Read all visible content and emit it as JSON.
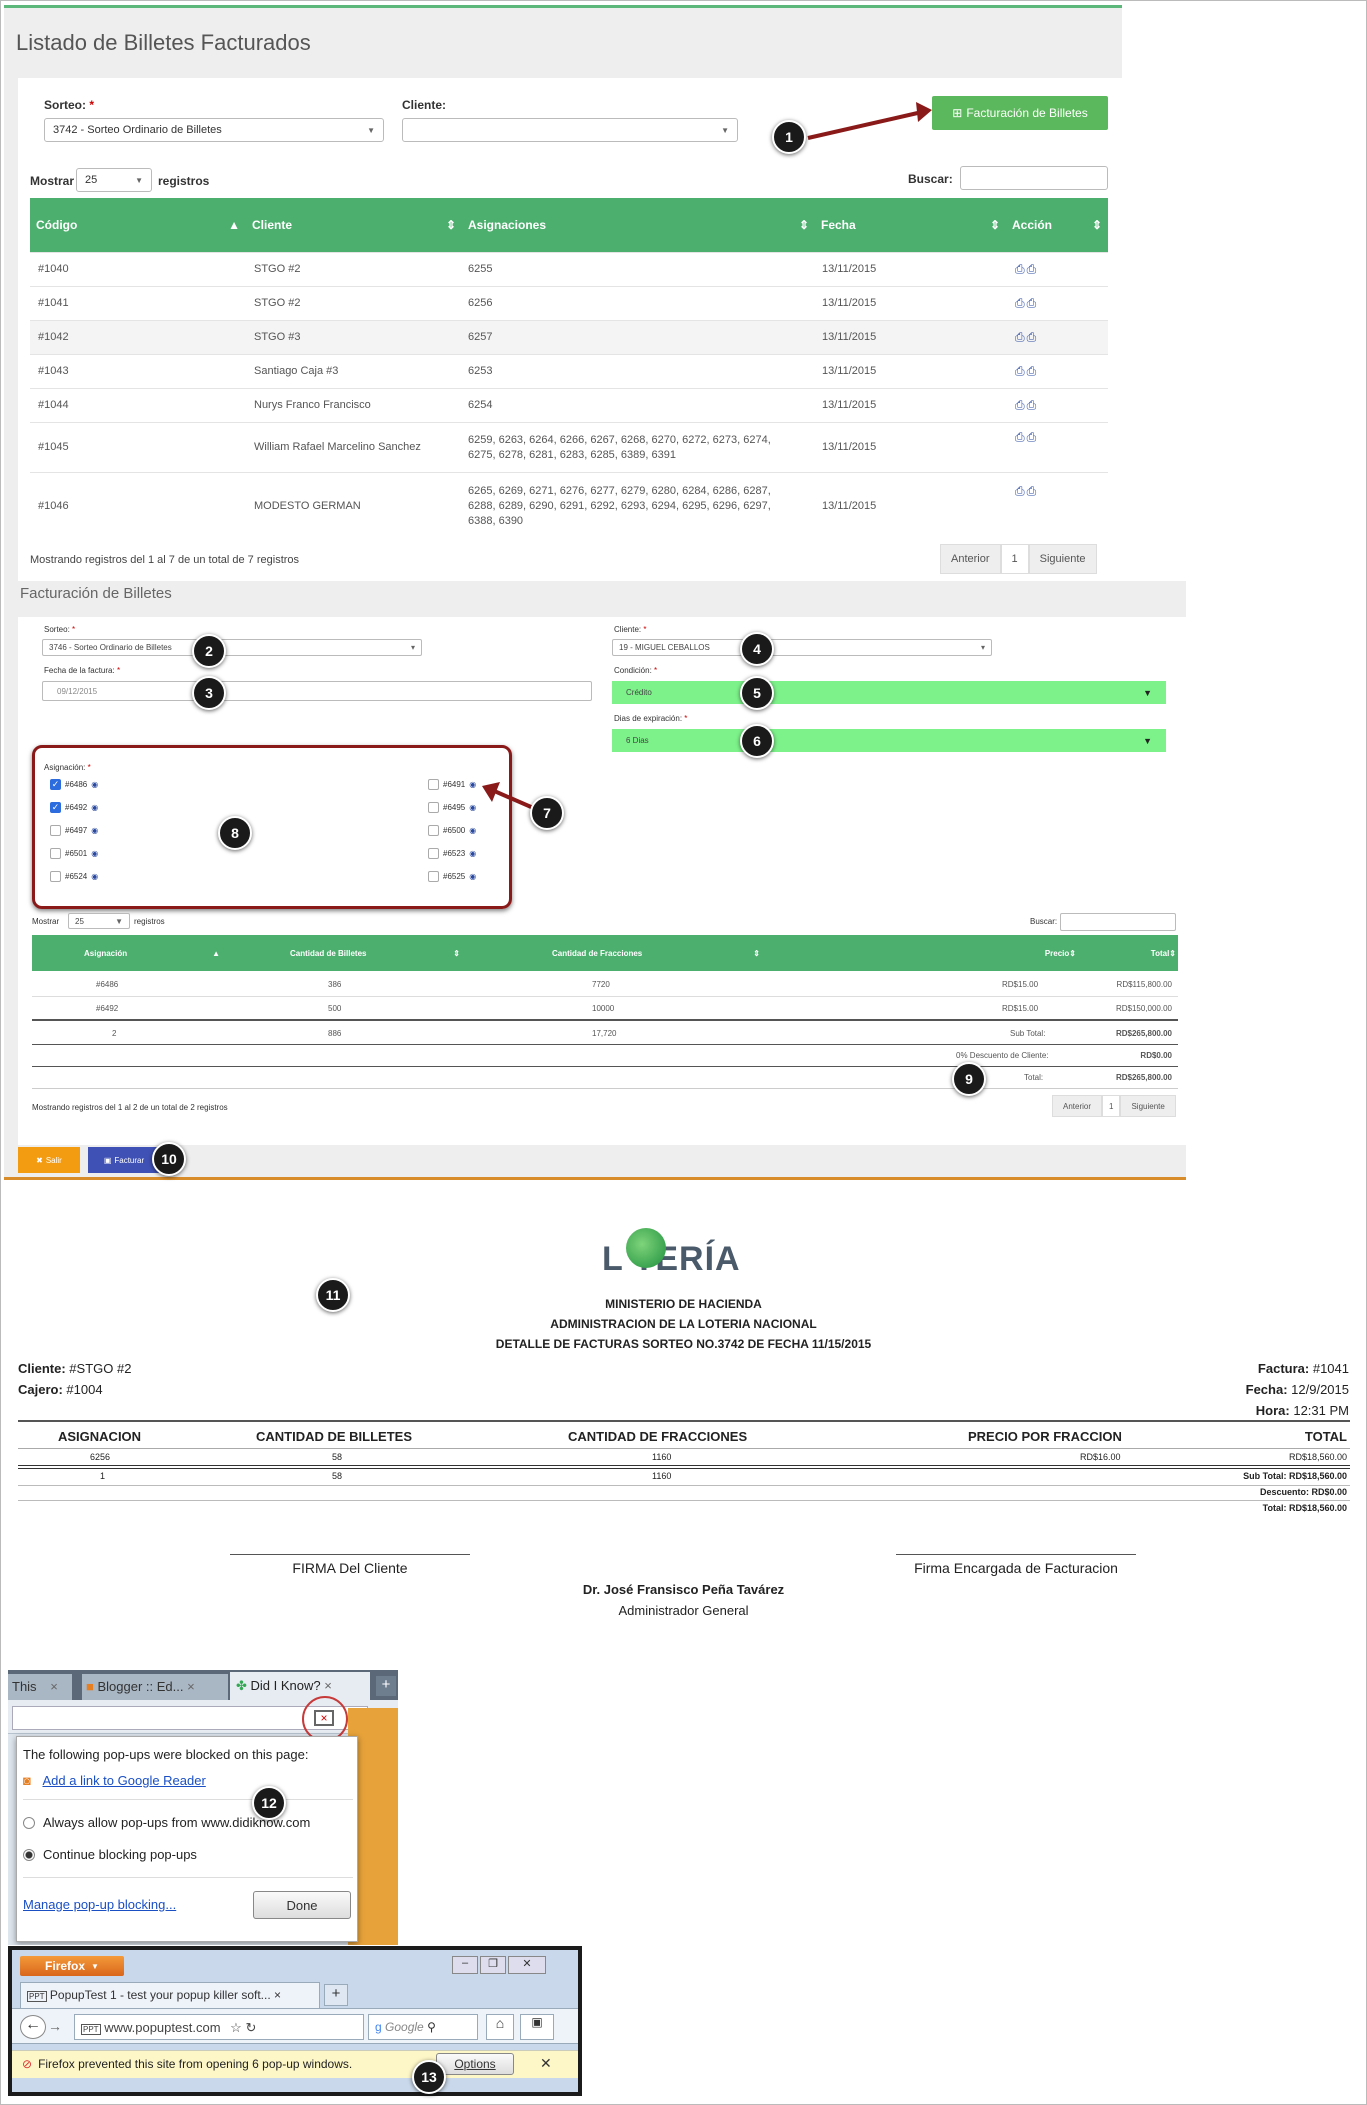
{
  "panel1": {
    "title": "Listado de Billetes Facturados",
    "sorteo_label": "Sorteo:",
    "sorteo_value": "3742 - Sorteo Ordinario de Billetes",
    "cliente_label": "Cliente:",
    "cliente_value": "",
    "add_button": "Facturación de Billetes",
    "show_label": "Mostrar",
    "show_value": "25",
    "records_label": "registros",
    "search_label": "Buscar:",
    "columns": [
      "Código",
      "Cliente",
      "Asignaciones",
      "Fecha",
      "Acción"
    ],
    "rows": [
      {
        "code": "#1040",
        "client": "STGO #2",
        "asig": "6255",
        "date": "13/11/2015"
      },
      {
        "code": "#1041",
        "client": "STGO #2",
        "asig": "6256",
        "date": "13/11/2015"
      },
      {
        "code": "#1042",
        "client": "STGO #3",
        "asig": "6257",
        "date": "13/11/2015"
      },
      {
        "code": "#1043",
        "client": "Santiago Caja #3",
        "asig": "6253",
        "date": "13/11/2015"
      },
      {
        "code": "#1044",
        "client": "Nurys Franco Francisco",
        "asig": "6254",
        "date": "13/11/2015"
      },
      {
        "code": "#1045",
        "client": "William Rafael Marcelino Sanchez",
        "asig": "6259, 6263, 6264, 6266, 6267, 6268, 6270, 6272, 6273, 6274, 6275, 6278, 6281, 6283, 6285, 6389, 6391",
        "date": "13/11/2015"
      },
      {
        "code": "#1046",
        "client": "MODESTO GERMAN",
        "asig": "6265, 6269, 6271, 6276, 6277, 6279, 6280, 6284, 6286, 6287, 6288, 6289, 6290, 6291, 6292, 6293, 6294, 6295, 6296, 6297, 6388, 6390",
        "date": "13/11/2015"
      }
    ],
    "footer_text": "Mostrando registros del 1 al 7 de un total de 7 registros",
    "prev": "Anterior",
    "page": "1",
    "next": "Siguiente"
  },
  "panel2": {
    "title": "Facturación de Billetes",
    "sorteo_label": "Sorteo:",
    "sorteo_value": "3746 - Sorteo Ordinario de Billetes",
    "fecha_label": "Fecha de la factura:",
    "fecha_value": "09/12/2015",
    "cliente_label": "Cliente:",
    "cliente_value": "19 - MIGUEL CEBALLOS",
    "condicion_label": "Condición:",
    "condicion_value": "Crédito",
    "dias_label": "Dias de expiración:",
    "dias_value": "6 Dias",
    "asig_label": "Asignación:",
    "left_items": [
      {
        "label": "#6486",
        "checked": true
      },
      {
        "label": "#6492",
        "checked": true
      },
      {
        "label": "#6497",
        "checked": false
      },
      {
        "label": "#6501",
        "checked": false
      },
      {
        "label": "#6524",
        "checked": false
      }
    ],
    "right_items": [
      {
        "label": "#6491",
        "checked": false
      },
      {
        "label": "#6495",
        "checked": false
      },
      {
        "label": "#6500",
        "checked": false
      },
      {
        "label": "#6523",
        "checked": false
      },
      {
        "label": "#6525",
        "checked": false
      }
    ],
    "show_label": "Mostrar",
    "show_value": "25",
    "records_label": "registros",
    "search_label": "Buscar:",
    "columns": [
      "Asignación",
      "Cantidad de Billetes",
      "Cantidad de Fracciones",
      "Precio",
      "Total"
    ],
    "rows": [
      {
        "a": "#6486",
        "b": "386",
        "c": "7720",
        "p": "RD$15.00",
        "t": "RD$115,800.00"
      },
      {
        "a": "#6492",
        "b": "500",
        "c": "10000",
        "p": "RD$15.00",
        "t": "RD$150,000.00"
      }
    ],
    "sum_row": {
      "a": "2",
      "b": "886",
      "c": "17,720",
      "p": "Sub Total:",
      "t": "RD$265,800.00"
    },
    "disc_row": {
      "p": "0% Descuento de Cliente:",
      "t": "RD$0.00"
    },
    "total_row": {
      "p": "Total:",
      "t": "RD$265,800.00"
    },
    "footer_text": "Mostrando registros del 1 al 2 de un total de 2 registros",
    "prev": "Anterior",
    "page": "1",
    "next": "Siguiente",
    "exit_button": "Salir",
    "bill_button": "Facturar"
  },
  "invoice": {
    "logo_text": "L TERÍA",
    "line1": "MINISTERIO DE HACIENDA",
    "line2": "ADMINISTRACION DE LA LOTERIA NACIONAL",
    "line3": "DETALLE DE FACTURAS SORTEO NO.3742 DE FECHA 11/15/2015",
    "cliente_label": "Cliente:",
    "cliente_value": "#STGO #2",
    "cajero_label": "Cajero:",
    "cajero_value": "#1004",
    "factura_label": "Factura:",
    "factura_value": "#1041",
    "fecha_label": "Fecha:",
    "fecha_value": "12/9/2015",
    "hora_label": "Hora:",
    "hora_value": "12:31 PM",
    "columns": [
      "ASIGNACION",
      "CANTIDAD DE BILLETES",
      "CANTIDAD DE FRACCIONES",
      "PRECIO POR FRACCION",
      "TOTAL"
    ],
    "row": {
      "a": "6256",
      "b": "58",
      "c": "1160",
      "p": "RD$16.00",
      "t": "RD$18,560.00"
    },
    "sum": {
      "a": "1",
      "b": "58",
      "c": "1160"
    },
    "subtotal": "Sub Total: RD$18,560.00",
    "descuento": "Descuento: RD$0.00",
    "total": "Total: RD$18,560.00",
    "sig_left": "FIRMA Del Cliente",
    "sig_right": "Firma Encargada de Facturacion",
    "admin_name": "Dr. José Fransisco Peña Tavárez",
    "admin_title": "Administrador General"
  },
  "chrome_popup": {
    "tabs": [
      "This",
      "Blogger :: Ed...",
      "Did I Know?"
    ],
    "message": "The following pop-ups were blocked on this page:",
    "link": "Add a link to Google Reader",
    "option1": "Always allow pop-ups from www.didiknow.com",
    "option2": "Continue blocking pop-ups",
    "manage": "Manage pop-up blocking...",
    "done": "Done"
  },
  "firefox_popup": {
    "menu": "Firefox",
    "tab": "PopupTest 1 - test your popup killer soft...",
    "url": "www.popuptest.com",
    "search_placeholder": "Google",
    "message": "Firefox prevented this site from opening 6 pop-up windows.",
    "options": "Options"
  },
  "markers": [
    "1",
    "2",
    "3",
    "4",
    "5",
    "6",
    "7",
    "8",
    "9",
    "10",
    "11",
    "12",
    "13"
  ]
}
